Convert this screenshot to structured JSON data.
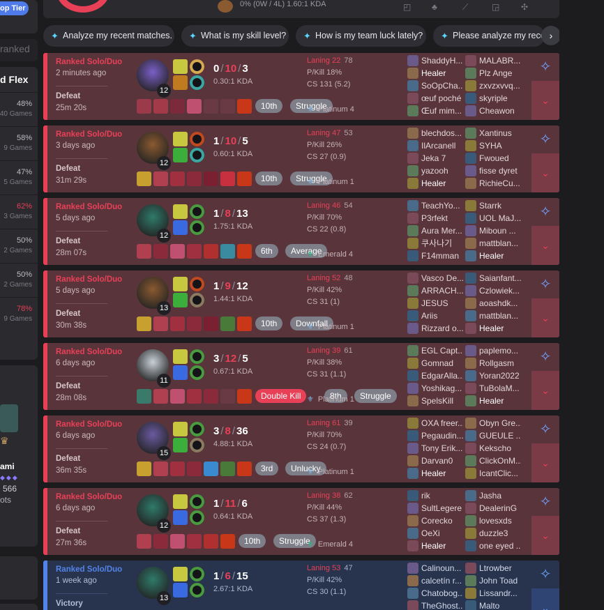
{
  "sidebar": {
    "top_tier_label": "op Tier",
    "ranked_label": "ranked",
    "flex_label": "d Flex",
    "rows": [
      {
        "pct": "48%",
        "games": "40 Games",
        "red": false
      },
      {
        "pct": "58%",
        "games": "9 Games",
        "red": false
      },
      {
        "pct": "47%",
        "games": "5 Games",
        "red": false
      },
      {
        "pct": "62%",
        "games": "3 Games",
        "red": true
      },
      {
        "pct": "50%",
        "games": "2 Games",
        "red": false
      },
      {
        "pct": "50%",
        "games": "2 Games",
        "red": false
      },
      {
        "pct": "78%",
        "games": "9 Games",
        "red": true
      }
    ],
    "profile_name": "ami",
    "profile_points": "566",
    "profile_extra": "ots"
  },
  "top_strip": {
    "summary": "0%  (0W / 4L)   1.60:1 KDA"
  },
  "quick_prompts": [
    "Analyze my recent matches.",
    "What is my skill level?",
    "How is my team luck lately?",
    "Please analyze my recent"
  ],
  "matches": [
    {
      "queue": "Ranked Solo/Duo",
      "ago": "2 minutes ago",
      "result": "Defeat",
      "duration": "25m 20s",
      "outcome": "defeat",
      "level": "12",
      "kills": "0",
      "deaths": "10",
      "assists": "3",
      "kda_ratio": "0.30:1 KDA",
      "champ_color": "#7a5fc7",
      "spell_colors": [
        "#c8c840",
        "#c07a20"
      ],
      "rune_colors": [
        "#d6a84f",
        "#3aa7a3"
      ],
      "items": [
        "#9b3a4a",
        "#a33a4a",
        "#7a2a3a",
        "#c05070",
        "#6a3a44",
        "#6a3a44",
        "#c83818"
      ],
      "badges": [
        {
          "text": "10th",
          "style": "gray"
        },
        {
          "text": "Struggle",
          "style": "gray"
        }
      ],
      "laning_label": "Laning 22",
      "laning_opp": "78",
      "pkill": "P/Kill 18%",
      "cs": "CS 131 (5.2)",
      "rank": "Platinum 4",
      "rank_type": "plat",
      "team_a": [
        "ShaddyH...",
        "Healer",
        "SoOpCha...",
        "œuf poché",
        "Œuf mim..."
      ],
      "team_b": [
        "MALABR...",
        "Plz Ange",
        "zxvzxvvq...",
        "skyriple",
        "Cheawon"
      ],
      "me_a": 1,
      "me_b": -1
    },
    {
      "queue": "Ranked Solo/Duo",
      "ago": "3 days ago",
      "result": "Defeat",
      "duration": "31m 29s",
      "outcome": "defeat",
      "level": "12",
      "kills": "1",
      "deaths": "10",
      "assists": "5",
      "kda_ratio": "0.60:1 KDA",
      "champ_color": "#8a5a30",
      "spell_colors": [
        "#c8c840",
        "#3cae3c"
      ],
      "rune_colors": [
        "#c04a20",
        "#3aa7a3"
      ],
      "items": [
        "#c8a030",
        "#b04050",
        "#a03040",
        "#8a2a3a",
        "#7a2030",
        "#c83040",
        "#c83818"
      ],
      "badges": [
        {
          "text": "10th",
          "style": "gray"
        },
        {
          "text": "Struggle",
          "style": "gray"
        }
      ],
      "laning_label": "Laning 47",
      "laning_opp": "53",
      "pkill": "P/Kill 26%",
      "cs": "CS 27 (0.9)",
      "rank": "Platinum 1",
      "rank_type": "plat",
      "team_a": [
        "blechdos...",
        "IlArcanell",
        "Jeka 7",
        "yazooh",
        "Healer"
      ],
      "team_b": [
        "Xantinus",
        "SYHA",
        "Fwoued",
        "fisse dyret",
        "RichieCu..."
      ],
      "me_a": 4,
      "me_b": -1
    },
    {
      "queue": "Ranked Solo/Duo",
      "ago": "5 days ago",
      "result": "Defeat",
      "duration": "28m 07s",
      "outcome": "defeat",
      "level": "12",
      "kills": "1",
      "deaths": "8",
      "assists": "13",
      "kda_ratio": "1.75:1 KDA",
      "champ_color": "#2f7a6a",
      "spell_colors": [
        "#c8c840",
        "#3a6ae0"
      ],
      "rune_colors": [
        "#4a9a40",
        "#4a9a40"
      ],
      "items": [
        "#b04050",
        "#8a2a3a",
        "#c05070",
        "#a03040",
        "#b03030",
        "#3a8aa0",
        "#c83818"
      ],
      "badges": [
        {
          "text": "6th",
          "style": "gray"
        },
        {
          "text": "Average",
          "style": "gray"
        }
      ],
      "laning_label": "Laning 46",
      "laning_opp": "54",
      "pkill": "P/Kill 70%",
      "cs": "CS 22 (0.8)",
      "rank": "Emerald 4",
      "rank_type": "emerald",
      "team_a": [
        "TeachYo...",
        "P3rfekt",
        "Aura Mer...",
        "쿠사나기",
        "F14mman"
      ],
      "team_b": [
        "Starrk",
        "UOL MaJ...",
        "Miboun ...",
        "mattblan...",
        "Healer"
      ],
      "me_a": -1,
      "me_b": 4
    },
    {
      "queue": "Ranked Solo/Duo",
      "ago": "5 days ago",
      "result": "Defeat",
      "duration": "30m 38s",
      "outcome": "defeat",
      "level": "13",
      "kills": "1",
      "deaths": "9",
      "assists": "12",
      "kda_ratio": "1.44:1 KDA",
      "champ_color": "#8a5a30",
      "spell_colors": [
        "#c8c840",
        "#3cae3c"
      ],
      "rune_colors": [
        "#c04a20",
        "#8a7a60"
      ],
      "items": [
        "#c8a030",
        "#b04050",
        "#a03040",
        "#8a2a3a",
        "#7a2030",
        "#4a7a3a",
        "#c83818"
      ],
      "badges": [
        {
          "text": "10th",
          "style": "gray"
        },
        {
          "text": "Downfall",
          "style": "gray"
        }
      ],
      "laning_label": "Laning 52",
      "laning_opp": "48",
      "pkill": "P/Kill 42%",
      "cs": "CS 31 (1)",
      "rank": "Platinum 1",
      "rank_type": "plat",
      "team_a": [
        "Vasco De...",
        "ARRACH...",
        "JESUS",
        "Ariis",
        "Rizzard o..."
      ],
      "team_b": [
        "Saianfant...",
        "Czlowiek...",
        "aoashdk...",
        "mattblan...",
        "Healer"
      ],
      "me_a": -1,
      "me_b": 4
    },
    {
      "queue": "Ranked Solo/Duo",
      "ago": "6 days ago",
      "result": "Defeat",
      "duration": "28m 08s",
      "outcome": "defeat",
      "level": "11",
      "kills": "3",
      "deaths": "12",
      "assists": "5",
      "kda_ratio": "0.67:1 KDA",
      "champ_color": "#c8d0d8",
      "spell_colors": [
        "#c8c840",
        "#3a6ae0"
      ],
      "rune_colors": [
        "#4a9a40",
        "#4a9a40"
      ],
      "items": [
        "#3a7a6a",
        "#b04050",
        "#c05070",
        "#a03040",
        "#8a2a3a",
        "#6a3a44",
        "#c83818"
      ],
      "badges": [
        {
          "text": "Double Kill",
          "style": "red"
        },
        {
          "text": "8th",
          "style": "gray"
        },
        {
          "text": "Struggle",
          "style": "gray"
        }
      ],
      "laning_label": "Laning 39",
      "laning_opp": "61",
      "pkill": "P/Kill 38%",
      "cs": "CS 31 (1.1)",
      "rank": "Platinum 1",
      "rank_type": "plat",
      "team_a": [
        "EGL Capt...",
        "Gomnad",
        "EdgarAlla...",
        "Yoshikag...",
        "SpelsKill"
      ],
      "team_b": [
        "paplemo...",
        "Rollgasm",
        "Yoran2022",
        "TuBolaM...",
        "Healer"
      ],
      "me_a": -1,
      "me_b": 4
    },
    {
      "queue": "Ranked Solo/Duo",
      "ago": "6 days ago",
      "result": "Defeat",
      "duration": "36m 35s",
      "outcome": "defeat",
      "level": "15",
      "kills": "3",
      "deaths": "8",
      "assists": "36",
      "kda_ratio": "4.88:1 KDA",
      "champ_color": "#6a5aa0",
      "spell_colors": [
        "#c8c840",
        "#3cae3c"
      ],
      "rune_colors": [
        "#4a9a40",
        "#8a7a60"
      ],
      "items": [
        "#c8a030",
        "#b04050",
        "#a03040",
        "#8a2a3a",
        "#3a8ad0",
        "#4a7a3a",
        "#c83818"
      ],
      "badges": [
        {
          "text": "3rd",
          "style": "gray"
        },
        {
          "text": "Unlucky",
          "style": "gray"
        }
      ],
      "laning_label": "Laning 61",
      "laning_opp": "39",
      "pkill": "P/Kill 70%",
      "cs": "CS 24 (0.7)",
      "rank": "Platinum 1",
      "rank_type": "plat",
      "team_a": [
        "OXA freer...",
        "Pegaudin...",
        "Tony Erik...",
        "Darvan0",
        "Healer"
      ],
      "team_b": [
        "Obyn Gre...",
        "GUEULE ...",
        "Kekscho",
        "ClickOnM...",
        "IcantClic..."
      ],
      "me_a": 4,
      "me_b": -1
    },
    {
      "queue": "Ranked Solo/Duo",
      "ago": "6 days ago",
      "result": "Defeat",
      "duration": "27m 36s",
      "outcome": "defeat",
      "level": "12",
      "kills": "1",
      "deaths": "11",
      "assists": "6",
      "kda_ratio": "0.64:1 KDA",
      "champ_color": "#2f7a6a",
      "spell_colors": [
        "#c8c840",
        "#3a6ae0"
      ],
      "rune_colors": [
        "#4a9a40",
        "#4a9a40"
      ],
      "items": [
        "#b04050",
        "#8a2a3a",
        "#c05070",
        "#a03040",
        "#b03030",
        "#c83818"
      ],
      "badges": [
        {
          "text": "10th",
          "style": "gray"
        },
        {
          "text": "Struggle",
          "style": "gray"
        }
      ],
      "laning_label": "Laning 38",
      "laning_opp": "62",
      "pkill": "P/Kill 44%",
      "cs": "CS 37 (1.3)",
      "rank": "Emerald 4",
      "rank_type": "emerald",
      "team_a": [
        "rik",
        "SultLegere",
        "Corecko",
        "OeXi",
        "Healer"
      ],
      "team_b": [
        "Jasha",
        "DealerinG",
        "lovesxds",
        "duzzle3",
        "one eyed ..."
      ],
      "me_a": 4,
      "me_b": -1
    },
    {
      "queue": "Ranked Solo/Duo",
      "ago": "1 week ago",
      "result": "Victory",
      "duration": "",
      "outcome": "victory",
      "level": "13",
      "kills": "1",
      "deaths": "6",
      "assists": "15",
      "kda_ratio": "2.67:1 KDA",
      "champ_color": "#2f7a6a",
      "spell_colors": [
        "#c8c840",
        "#3a6ae0"
      ],
      "rune_colors": [
        "#4a9a40",
        "#4a9a40"
      ],
      "items": [],
      "badges": [],
      "laning_label": "Laning 53",
      "laning_opp": "47",
      "pkill": "P/Kill 42%",
      "cs": "CS 30 (1.1)",
      "rank": "Platinum 1",
      "rank_type": "plat",
      "team_a": [
        "Calinoun...",
        "calcetín r...",
        "Chatobog...",
        "TheGhost..."
      ],
      "team_b": [
        "Ltrowber",
        "John Toad",
        "Lissandr...",
        "Malto"
      ],
      "me_a": -1,
      "me_b": -1
    }
  ],
  "icons": {
    "ai_icon": "sparkle-robot-icon",
    "expand_icon": "chevron-down-icon",
    "next_icon": "chevron-right-icon"
  },
  "colors": {
    "defeat": "#e84057",
    "victory": "#5383e8",
    "accent": "#4f7bea"
  }
}
